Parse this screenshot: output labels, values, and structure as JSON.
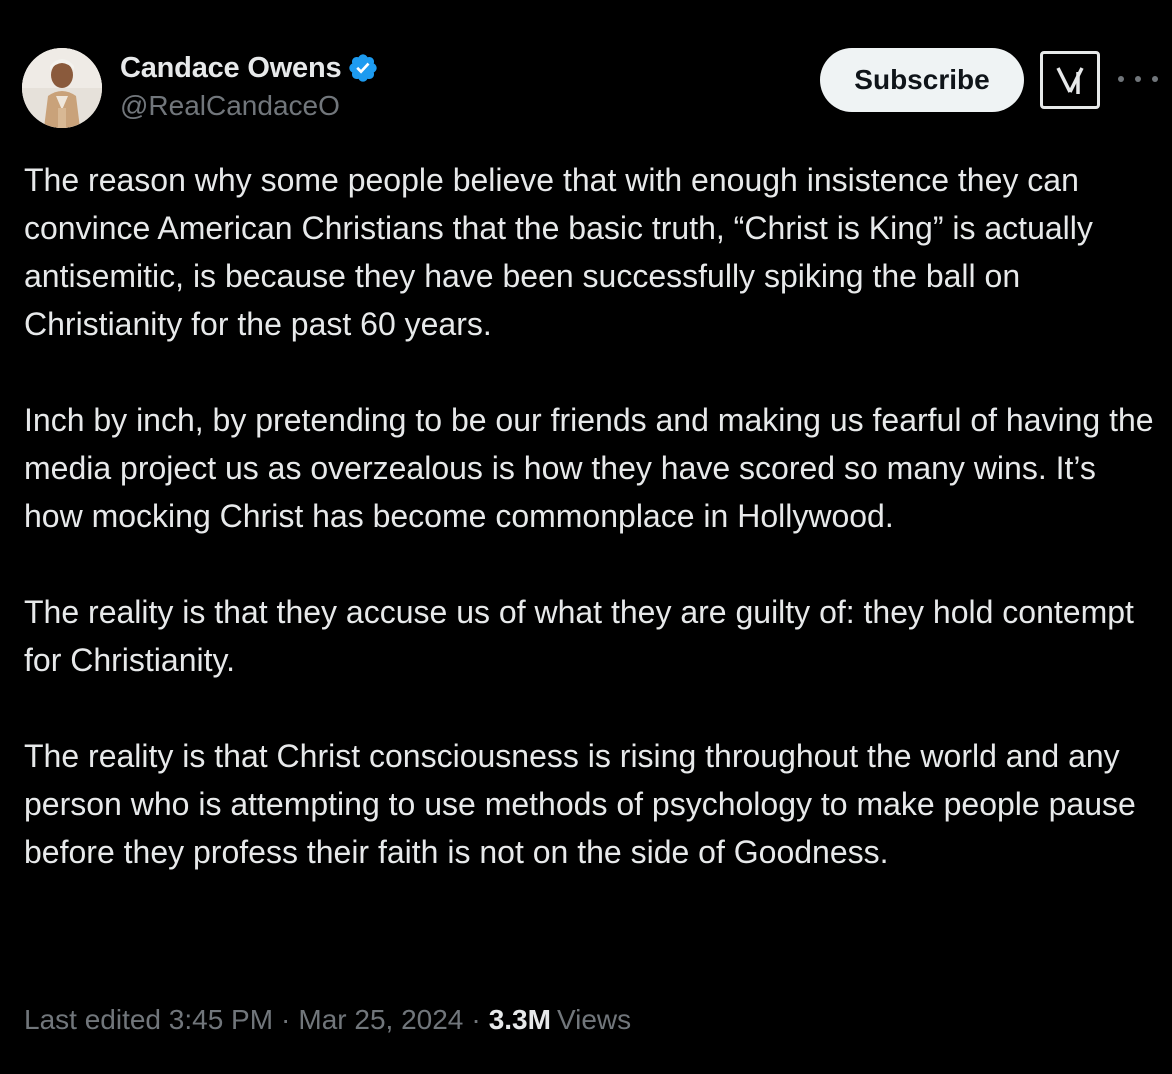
{
  "author": {
    "display_name": "Candace Owens",
    "handle": "@RealCandaceO",
    "verified_badge": "verified-check-icon",
    "verified_color": "#1d9bf0"
  },
  "actions": {
    "subscribe_label": "Subscribe",
    "grok_icon": "grok-icon",
    "more_icon": "more-dots-icon"
  },
  "body": {
    "paragraphs": [
      "The reason why some people believe that with enough insistence they can convince American Christians that the basic truth, “Christ is King” is actually antisemitic, is because they have been successfully spiking the ball on Christianity for the past 60 years.",
      "Inch by inch, by pretending to be our friends and making us fearful of having the media project us as overzealous is how they have scored so many wins. It’s how mocking Christ has become commonplace in Hollywood.",
      "The reality is that they accuse us of what they are guilty of: they hold contempt for Christianity.",
      "The reality is that Christ consciousness is rising throughout the world and any person who is attempting to use methods of psychology to make people pause before they profess their faith is not on the side of Goodness."
    ]
  },
  "meta": {
    "edited_label": "Last edited 3:45 PM",
    "separator": "·",
    "date": "Mar 25, 2024",
    "views_count": "3.3M",
    "views_label": "Views"
  },
  "colors": {
    "background": "#000000",
    "text_primary": "#e7e9ea",
    "text_secondary": "#71767b",
    "button_bg": "#eff3f4"
  }
}
